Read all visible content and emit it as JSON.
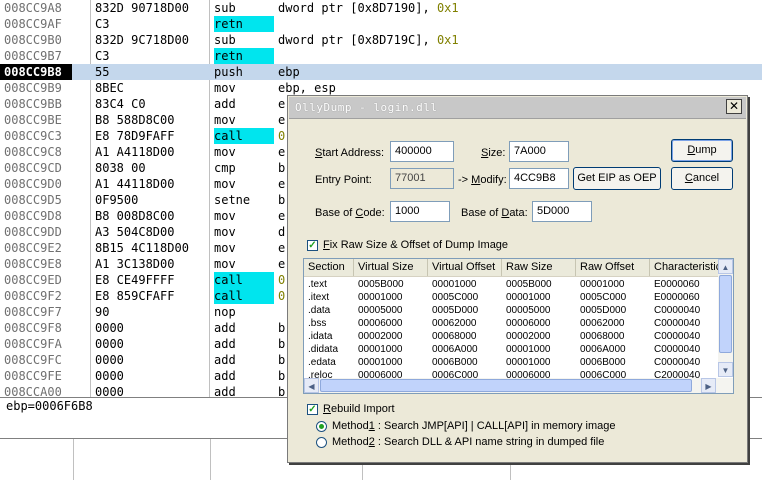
{
  "disasm": {
    "rows": [
      {
        "addr": "008CC9A8",
        "hex": "832D 90718D00",
        "mn": "sub",
        "op_pre": "dword ptr [0x8D7190], ",
        "op_num": "0x1",
        "hl": false,
        "sel": false
      },
      {
        "addr": "008CC9AF",
        "hex": "C3",
        "mn": "retn",
        "op_pre": "",
        "op_num": "",
        "hl": true,
        "sel": false
      },
      {
        "addr": "008CC9B0",
        "hex": "832D 9C718D00",
        "mn": "sub",
        "op_pre": "dword ptr [0x8D719C], ",
        "op_num": "0x1",
        "hl": false,
        "sel": false
      },
      {
        "addr": "008CC9B7",
        "hex": "C3",
        "mn": "retn",
        "op_pre": "",
        "op_num": "",
        "hl": true,
        "sel": false
      },
      {
        "addr": "008CC9B8",
        "hex": "55",
        "mn": "push",
        "op_pre": "ebp",
        "op_num": "",
        "hl": false,
        "sel": true
      },
      {
        "addr": "008CC9B9",
        "hex": "8BEC",
        "mn": "mov",
        "op_pre": "ebp, esp",
        "op_num": "",
        "hl": false,
        "sel": false
      },
      {
        "addr": "008CC9BB",
        "hex": "83C4 C0",
        "mn": "add",
        "op_pre": "e",
        "op_num": "",
        "hl": false,
        "sel": false
      },
      {
        "addr": "008CC9BE",
        "hex": "B8 588D8C00",
        "mn": "mov",
        "op_pre": "e",
        "op_num": "",
        "hl": false,
        "sel": false
      },
      {
        "addr": "008CC9C3",
        "hex": "E8 78D9FAFF",
        "mn": "call",
        "op_pre": "",
        "op_num": "0",
        "hl": true,
        "sel": false
      },
      {
        "addr": "008CC9C8",
        "hex": "A1 A4118D00",
        "mn": "mov",
        "op_pre": "e",
        "op_num": "",
        "hl": false,
        "sel": false
      },
      {
        "addr": "008CC9CD",
        "hex": "8038 00",
        "mn": "cmp",
        "op_pre": "b",
        "op_num": "",
        "hl": false,
        "sel": false
      },
      {
        "addr": "008CC9D0",
        "hex": "A1 44118D00",
        "mn": "mov",
        "op_pre": "e",
        "op_num": "",
        "hl": false,
        "sel": false
      },
      {
        "addr": "008CC9D5",
        "hex": "0F9500",
        "mn": "setne",
        "op_pre": "b",
        "op_num": "",
        "hl": false,
        "sel": false
      },
      {
        "addr": "008CC9D8",
        "hex": "B8 008D8C00",
        "mn": "mov",
        "op_pre": "e",
        "op_num": "",
        "hl": false,
        "sel": false
      },
      {
        "addr": "008CC9DD",
        "hex": "A3 504C8D00",
        "mn": "mov",
        "op_pre": "d",
        "op_num": "",
        "hl": false,
        "sel": false
      },
      {
        "addr": "008CC9E2",
        "hex": "8B15 4C118D00",
        "mn": "mov",
        "op_pre": "e",
        "op_num": "",
        "hl": false,
        "sel": false
      },
      {
        "addr": "008CC9E8",
        "hex": "A1 3C138D00",
        "mn": "mov",
        "op_pre": "e",
        "op_num": "",
        "hl": false,
        "sel": false
      },
      {
        "addr": "008CC9ED",
        "hex": "E8 CE49FFFF",
        "mn": "call",
        "op_pre": "",
        "op_num": "0",
        "hl": true,
        "sel": false
      },
      {
        "addr": "008CC9F2",
        "hex": "E8 859CFAFF",
        "mn": "call",
        "op_pre": "",
        "op_num": "0",
        "hl": true,
        "sel": false
      },
      {
        "addr": "008CC9F7",
        "hex": "90",
        "mn": "nop",
        "op_pre": "",
        "op_num": "",
        "hl": false,
        "sel": false
      },
      {
        "addr": "008CC9F8",
        "hex": "0000",
        "mn": "add",
        "op_pre": "b",
        "op_num": "",
        "hl": false,
        "sel": false
      },
      {
        "addr": "008CC9FA",
        "hex": "0000",
        "mn": "add",
        "op_pre": "b",
        "op_num": "",
        "hl": false,
        "sel": false
      },
      {
        "addr": "008CC9FC",
        "hex": "0000",
        "mn": "add",
        "op_pre": "b",
        "op_num": "",
        "hl": false,
        "sel": false
      },
      {
        "addr": "008CC9FE",
        "hex": "0000",
        "mn": "add",
        "op_pre": "b",
        "op_num": "",
        "hl": false,
        "sel": false
      },
      {
        "addr": "008CCA00",
        "hex": "0000",
        "mn": "add",
        "op_pre": "b",
        "op_num": "",
        "hl": false,
        "sel": false
      }
    ],
    "info_text": "ebp=0006F6B8"
  },
  "dialog": {
    "title": "OllyDump - login.dll",
    "close_glyph": "✕",
    "start_address_label_u": "S",
    "start_address_label_rest": "tart Address:",
    "start_address_value": "400000",
    "size_label_u": "S",
    "size_label_rest": "ize:",
    "size_value": "7A000",
    "entry_point_label": "Entry Point:",
    "entry_point_value": "77001",
    "modify_label_pre": "-> ",
    "modify_label_u": "M",
    "modify_label_rest": "odify:",
    "modify_value": "4CC9B8",
    "get_eip_button": "Get EIP as OEP",
    "dump_button_u": "D",
    "dump_button_rest": "ump",
    "cancel_button_u": "C",
    "cancel_button_rest": "ancel",
    "base_code_label_pre": "Base of ",
    "base_code_label_u": "C",
    "base_code_label_rest": "ode:",
    "base_code_value": "1000",
    "base_data_label_pre": "Base of ",
    "base_data_label_u": "D",
    "base_data_label_rest": "ata:",
    "base_data_value": "5D000",
    "fix_raw_check": "✓",
    "fix_raw_label_u": "F",
    "fix_raw_label_rest": "ix Raw Size & Offset of Dump Image",
    "sections": {
      "columns": [
        "Section",
        "Virtual Size",
        "Virtual Offset",
        "Raw Size",
        "Raw Offset",
        "Characteristic"
      ],
      "rows": [
        [
          ".text",
          "0005B000",
          "00001000",
          "0005B000",
          "00001000",
          "E0000060"
        ],
        [
          ".itext",
          "00001000",
          "0005C000",
          "00001000",
          "0005C000",
          "E0000060"
        ],
        [
          ".data",
          "00005000",
          "0005D000",
          "00005000",
          "0005D000",
          "C0000040"
        ],
        [
          ".bss",
          "00006000",
          "00062000",
          "00006000",
          "00062000",
          "C0000040"
        ],
        [
          ".idata",
          "00002000",
          "00068000",
          "00002000",
          "00068000",
          "C0000040"
        ],
        [
          ".didata",
          "00001000",
          "0006A000",
          "00001000",
          "0006A000",
          "C0000040"
        ],
        [
          ".edata",
          "00001000",
          "0006B000",
          "00001000",
          "0006B000",
          "C0000040"
        ],
        [
          ".reloc",
          "00006000",
          "0006C000",
          "00006000",
          "0006C000",
          "C2000040"
        ]
      ],
      "scroll_up": "▲",
      "scroll_down": "▼",
      "scroll_left": "◀",
      "scroll_right": "▶"
    },
    "rebuild_check": "✓",
    "rebuild_label_u": "R",
    "rebuild_label_rest": "ebuild Import",
    "method1_pre": "Method",
    "method1_u": "1",
    "method1_rest": " : Search JMP[API] | CALL[API] in memory image",
    "method2_pre": "Method",
    "method2_u": "2",
    "method2_rest": " : Search DLL & API name string in dumped file"
  }
}
